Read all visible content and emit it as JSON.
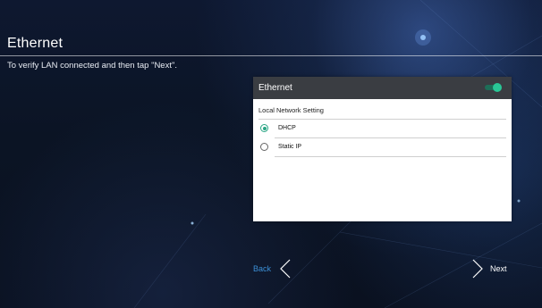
{
  "page": {
    "title": "Ethernet",
    "instruction": "To verify LAN connected and then tap \"Next\"."
  },
  "panel": {
    "header_title": "Ethernet",
    "toggle_on": true,
    "section_label": "Local Network Setting",
    "options": [
      {
        "label": "DHCP",
        "selected": true
      },
      {
        "label": "Static IP",
        "selected": false
      }
    ]
  },
  "nav": {
    "back_label": "Back",
    "next_label": "Next"
  },
  "colors": {
    "accent": "#29a584",
    "back_link": "#3b8fd6",
    "header_bg": "#3a3d42"
  }
}
